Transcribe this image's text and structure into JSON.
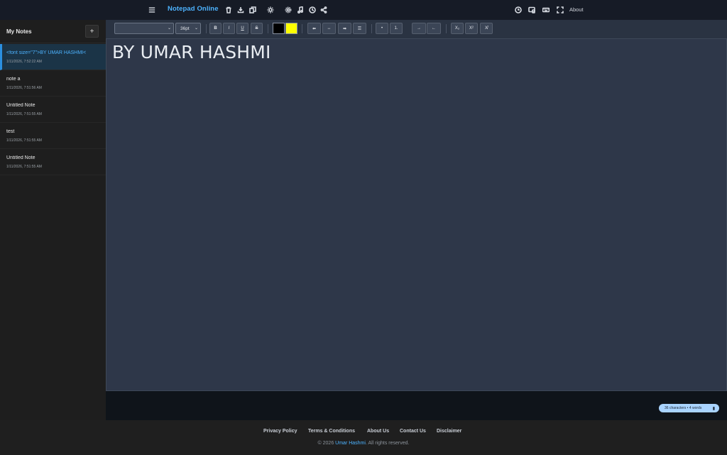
{
  "topbar": {
    "brand": "Notepad Online",
    "about_label": "About",
    "left_icons": [
      "menu-icon"
    ],
    "brand_icons": [
      "trash-icon",
      "download-icon",
      "copy-icon",
      "sun-icon",
      "gear-icon",
      "music-icon",
      "clock-icon",
      "share-icon"
    ],
    "right_icons": [
      "clock-icon",
      "tablet-icon",
      "keyboard-icon",
      "fullscreen-icon"
    ]
  },
  "sidebar": {
    "title": "My Notes",
    "add_label": "+",
    "notes": [
      {
        "title": "<font size=\"7\">BY UMAR HASHMI<",
        "date": "1/11/2026, 7:52:22 AM",
        "active": true
      },
      {
        "title": "note a",
        "date": "1/11/2026, 7:51:56 AM",
        "active": false
      },
      {
        "title": "Untitled Note",
        "date": "1/11/2026, 7:51:55 AM",
        "active": false
      },
      {
        "title": "test",
        "date": "1/11/2026, 7:51:55 AM",
        "active": false
      },
      {
        "title": "Untitled Note",
        "date": "1/11/2026, 7:51:55 AM",
        "active": false
      }
    ]
  },
  "toolbar": {
    "font_family_value": "",
    "font_size_value": "36pt",
    "bold": "B",
    "italic": "I",
    "underline": "U",
    "strike": "S",
    "text_color": "#000000",
    "highlight_color": "#ffff00",
    "align_left": "⬅",
    "align_center": "↔",
    "align_right": "➡",
    "align_justify": "☰",
    "bullet": "•",
    "numbered": "1.",
    "indent": "→",
    "outdent": "←",
    "subscript": "X₂",
    "superscript": "X²",
    "clear_format": "X̸"
  },
  "editor": {
    "content": "BY UMAR HASHMI"
  },
  "status": {
    "counter": "36 characters • 4 words"
  },
  "footer": {
    "links": [
      "Privacy Policy",
      "Terms & Conditions",
      "About Us",
      "Contact Us",
      "Disclaimer"
    ],
    "copy_prefix": "© 2026 ",
    "copy_author": "Umar Hashmi",
    "copy_suffix": ". All rights reserved."
  },
  "colors": {
    "accent": "#4db3ff",
    "active_note_bg": "#1b3447",
    "editor_bg": "#2e3749",
    "counter_bg": "#a9d4ff"
  }
}
